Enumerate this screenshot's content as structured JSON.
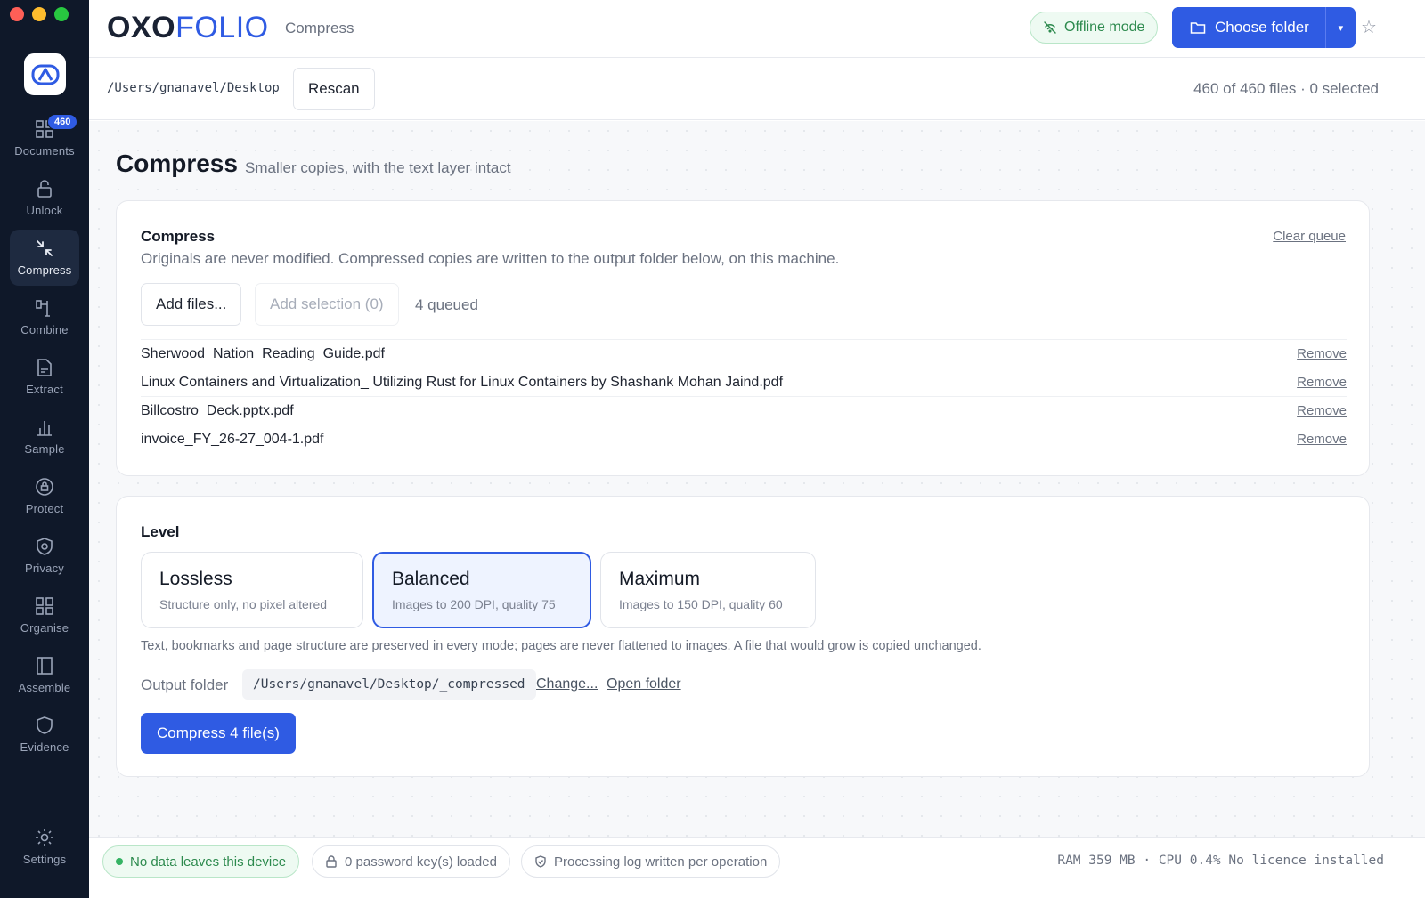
{
  "brand": {
    "part1": "OXO",
    "part2": "FOLIO"
  },
  "header": {
    "section": "Compress",
    "offline_label": "Offline mode",
    "choose_folder_label": "Choose folder"
  },
  "sidebar": {
    "items": [
      {
        "label": "Documents",
        "icon": "grid-icon",
        "badge": "460"
      },
      {
        "label": "Unlock",
        "icon": "unlock-icon"
      },
      {
        "label": "Compress",
        "icon": "compress-icon",
        "active": true
      },
      {
        "label": "Combine",
        "icon": "combine-icon"
      },
      {
        "label": "Extract",
        "icon": "extract-icon"
      },
      {
        "label": "Sample",
        "icon": "bar-chart-icon"
      },
      {
        "label": "Protect",
        "icon": "shield-lock-icon"
      },
      {
        "label": "Privacy",
        "icon": "shield-icon"
      },
      {
        "label": "Organise",
        "icon": "organise-icon"
      },
      {
        "label": "Assemble",
        "icon": "assemble-icon"
      },
      {
        "label": "Evidence",
        "icon": "evidence-shield-icon"
      }
    ],
    "settings_label": "Settings"
  },
  "pathbar": {
    "path": "/Users/gnanavel/Desktop",
    "rescan_label": "Rescan",
    "file_count": "460 of 460 files · 0 selected"
  },
  "page": {
    "title": "Compress",
    "subtitle": "Smaller copies, with the text layer intact"
  },
  "queue_card": {
    "heading": "Compress",
    "description": "Originals are never modified. Compressed copies are written to the output folder below, on this machine.",
    "clear_label": "Clear queue",
    "add_files_label": "Add files...",
    "add_selection_label": "Add selection (0)",
    "queued_label": "4 queued",
    "remove_label": "Remove",
    "files": [
      "Sherwood_Nation_Reading_Guide.pdf",
      "Linux Containers and Virtualization_ Utilizing Rust for Linux Containers by Shashank Mohan Jaind.pdf",
      "Billcostro_Deck.pptx.pdf",
      "invoice_FY_26-27_004-1.pdf"
    ]
  },
  "level_card": {
    "heading": "Level",
    "levels": [
      {
        "title": "Lossless",
        "desc": "Structure only, no pixel altered"
      },
      {
        "title": "Balanced",
        "desc": "Images to 200 DPI, quality 75",
        "selected": true
      },
      {
        "title": "Maximum",
        "desc": "Images to 150 DPI, quality 60"
      }
    ],
    "note": "Text, bookmarks and page structure are preserved in every mode; pages are never flattened to images. A file that would grow is copied unchanged.",
    "output_label": "Output folder",
    "output_path": "/Users/gnanavel/Desktop/_compressed",
    "change_label": "Change...",
    "open_label": "Open folder",
    "compress_label": "Compress 4 file(s)"
  },
  "status": {
    "privacy": "No data leaves this device",
    "keys": "0 password key(s) loaded",
    "log": "Processing log written per operation",
    "system": "RAM 359 MB · CPU 0.4% No licence installed"
  },
  "colors": {
    "accent": "#2f5be3",
    "sidebar": "#0f1829",
    "success": "#2d8a4e"
  }
}
